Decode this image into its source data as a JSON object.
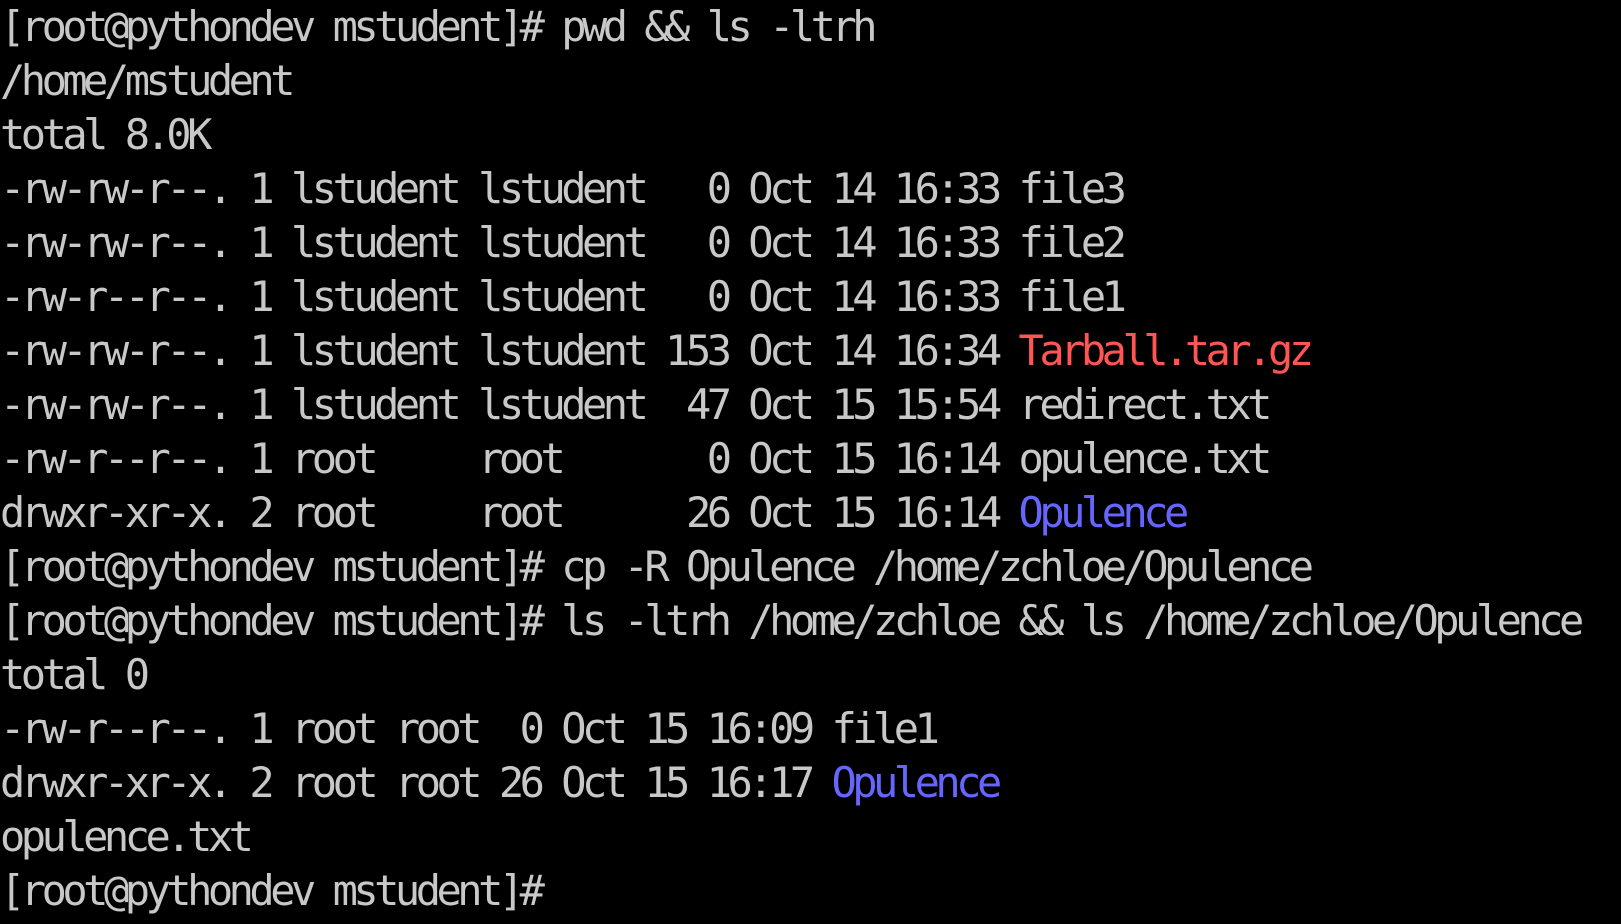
{
  "colors": {
    "background": "#000000",
    "foreground": "#c8c8c8",
    "archive": "#ff5555",
    "directory": "#6666ff"
  },
  "terminal": {
    "lines": [
      {
        "text": "[root@pythondev mstudent]# pwd && ls -ltrh"
      },
      {
        "text": "/home/mstudent"
      },
      {
        "text": "total 8.0K"
      },
      {
        "text": "-rw-rw-r--. 1 lstudent lstudent   0 Oct 14 16:33 ",
        "name": "file3",
        "kind": "plain"
      },
      {
        "text": "-rw-rw-r--. 1 lstudent lstudent   0 Oct 14 16:33 ",
        "name": "file2",
        "kind": "plain"
      },
      {
        "text": "-rw-r--r--. 1 lstudent lstudent   0 Oct 14 16:33 ",
        "name": "file1",
        "kind": "plain"
      },
      {
        "text": "-rw-rw-r--. 1 lstudent lstudent 153 Oct 14 16:34 ",
        "name": "Tarball.tar.gz",
        "kind": "archive"
      },
      {
        "text": "-rw-rw-r--. 1 lstudent lstudent  47 Oct 15 15:54 ",
        "name": "redirect.txt",
        "kind": "plain"
      },
      {
        "text": "-rw-r--r--. 1 root     root       0 Oct 15 16:14 ",
        "name": "opulence.txt",
        "kind": "plain"
      },
      {
        "text": "drwxr-xr-x. 2 root     root      26 Oct 15 16:14 ",
        "name": "Opulence",
        "kind": "dir"
      },
      {
        "text": "[root@pythondev mstudent]# cp -R Opulence /home/zchloe/Opulence"
      },
      {
        "text": "[root@pythondev mstudent]# ls -ltrh /home/zchloe && ls /home/zchloe/Opulence"
      },
      {
        "text": "total 0"
      },
      {
        "text": "-rw-r--r--. 1 root root  0 Oct 15 16:09 ",
        "name": "file1",
        "kind": "plain"
      },
      {
        "text": "drwxr-xr-x. 2 root root 26 Oct 15 16:17 ",
        "name": "Opulence",
        "kind": "dir"
      },
      {
        "text": "opulence.txt"
      },
      {
        "text": "[root@pythondev mstudent]#"
      }
    ]
  }
}
